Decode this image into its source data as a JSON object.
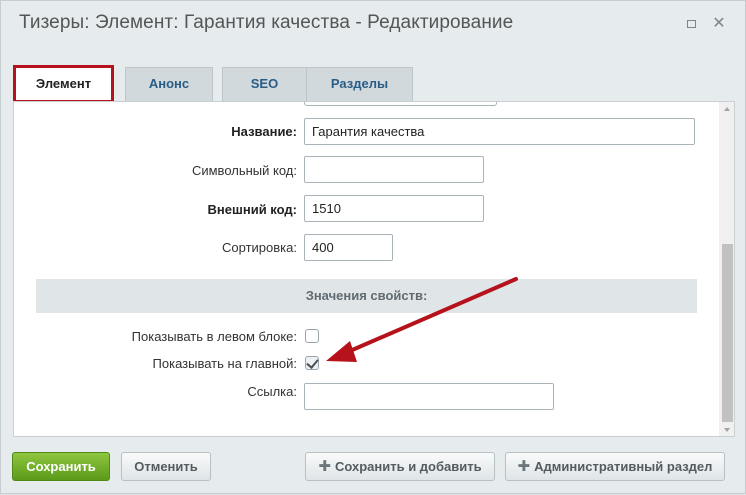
{
  "window": {
    "title": "Тизеры: Элемент: Гарантия качества - Редактирование"
  },
  "tabs": [
    {
      "label": "Элемент",
      "active": true
    },
    {
      "label": "Анонс",
      "active": false
    },
    {
      "label": "SEO",
      "active": false
    },
    {
      "label": "Разделы",
      "active": false
    }
  ],
  "form": {
    "name_label": "Название:",
    "name_value": "Гарантия качества",
    "code_label": "Символьный код:",
    "code_value": "",
    "external_label": "Внешний код:",
    "external_value": "1510",
    "sort_label": "Сортировка:",
    "sort_value": "400",
    "section_title": "Значения свойств:",
    "show_left_label": "Показывать в левом блоке:",
    "show_left_checked": false,
    "show_main_label": "Показывать на главной:",
    "show_main_checked": true,
    "link_label": "Ссылка:",
    "link_value": ""
  },
  "footer": {
    "save_label": "Сохранить",
    "cancel_label": "Отменить",
    "save_add_label": "Сохранить и добавить",
    "admin_label": "Административный раздел"
  },
  "colors": {
    "active_tab_border": "#b5121b",
    "annotation_arrow": "#b5121b",
    "save_button": "#6aa92a"
  },
  "icons": {
    "maximize": "maximize-icon",
    "close": "close-icon",
    "plus": "plus-icon",
    "arrow": "annotation-arrow-icon"
  }
}
